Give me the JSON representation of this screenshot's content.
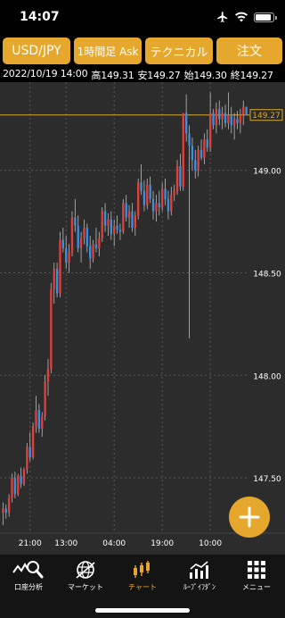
{
  "status_bar": {
    "time": "14:07"
  },
  "toolbar": {
    "symbol": "USD/JPY",
    "period": "1時間足 Ask",
    "technical": "テクニカル",
    "order": "注文"
  },
  "ohlc": {
    "datetime": "2022/10/19 14:00",
    "high": "高149.31",
    "low": "安149.27",
    "open": "始149.30",
    "close": "終149.27"
  },
  "chart_data": {
    "type": "candlestick",
    "y_ticks": [
      "149.00",
      "148.50",
      "148.00",
      "147.50"
    ],
    "y_tick_values": [
      149.0,
      148.5,
      148.0,
      147.5
    ],
    "ylim": [
      147.23,
      149.43
    ],
    "x_ticks": [
      "21:00",
      "13:00",
      "04:00",
      "19:00",
      "10:00"
    ],
    "current_price": "149.27",
    "current_price_value": 149.27,
    "colors": {
      "up": "#e0403a",
      "down": "#3b8fe0",
      "price_line": "#d9a830",
      "grid": "#5a5a5a",
      "background": "#2c2c2c"
    },
    "candles": [
      [
        147.33,
        147.38,
        147.27,
        147.35
      ],
      [
        147.35,
        147.37,
        147.3,
        147.33
      ],
      [
        147.33,
        147.42,
        147.31,
        147.4
      ],
      [
        147.4,
        147.52,
        147.38,
        147.5
      ],
      [
        147.5,
        147.53,
        147.4,
        147.42
      ],
      [
        147.42,
        147.52,
        147.41,
        147.51
      ],
      [
        147.51,
        147.55,
        147.45,
        147.47
      ],
      [
        147.47,
        147.55,
        147.46,
        147.54
      ],
      [
        147.54,
        147.67,
        147.52,
        147.65
      ],
      [
        147.65,
        147.72,
        147.58,
        147.6
      ],
      [
        147.6,
        147.77,
        147.59,
        147.75
      ],
      [
        147.75,
        147.9,
        147.72,
        147.83
      ],
      [
        147.83,
        147.86,
        147.72,
        147.74
      ],
      [
        147.74,
        147.82,
        147.7,
        147.8
      ],
      [
        147.8,
        148.0,
        147.78,
        147.97
      ],
      [
        147.97,
        148.08,
        147.9,
        148.03
      ],
      [
        148.03,
        148.45,
        148.01,
        148.42
      ],
      [
        148.42,
        148.55,
        148.35,
        148.52
      ],
      [
        148.52,
        148.55,
        148.38,
        148.4
      ],
      [
        148.4,
        148.7,
        148.38,
        148.66
      ],
      [
        148.66,
        148.72,
        148.6,
        148.62
      ],
      [
        148.62,
        148.68,
        148.52,
        148.55
      ],
      [
        148.55,
        148.64,
        148.5,
        148.6
      ],
      [
        148.6,
        148.8,
        148.58,
        148.77
      ],
      [
        148.77,
        148.86,
        148.7,
        148.73
      ],
      [
        148.73,
        148.78,
        148.6,
        148.62
      ],
      [
        148.62,
        148.7,
        148.55,
        148.67
      ],
      [
        148.67,
        148.76,
        148.64,
        148.72
      ],
      [
        148.72,
        148.74,
        148.6,
        148.63
      ],
      [
        148.63,
        148.68,
        148.52,
        148.57
      ],
      [
        148.57,
        148.66,
        148.55,
        148.64
      ],
      [
        148.64,
        148.72,
        148.6,
        148.62
      ],
      [
        148.62,
        148.7,
        148.58,
        148.67
      ],
      [
        148.67,
        148.82,
        148.65,
        148.8
      ],
      [
        148.8,
        148.84,
        148.7,
        148.73
      ],
      [
        148.73,
        148.79,
        148.68,
        148.76
      ],
      [
        148.76,
        148.8,
        148.66,
        148.69
      ],
      [
        148.69,
        148.76,
        148.63,
        148.73
      ],
      [
        148.73,
        148.78,
        148.69,
        148.71
      ],
      [
        148.71,
        148.74,
        148.66,
        148.7
      ],
      [
        148.7,
        148.86,
        148.69,
        148.84
      ],
      [
        148.84,
        148.88,
        148.75,
        148.77
      ],
      [
        148.77,
        148.83,
        148.72,
        148.8
      ],
      [
        148.8,
        148.84,
        148.7,
        148.72
      ],
      [
        148.72,
        148.8,
        148.68,
        148.78
      ],
      [
        148.78,
        148.96,
        148.76,
        148.94
      ],
      [
        148.94,
        149.03,
        148.88,
        148.9
      ],
      [
        148.9,
        148.95,
        148.8,
        148.83
      ],
      [
        148.83,
        148.96,
        148.81,
        148.93
      ],
      [
        148.93,
        148.97,
        148.84,
        148.86
      ],
      [
        148.86,
        148.9,
        148.76,
        148.8
      ],
      [
        148.8,
        148.88,
        148.75,
        148.84
      ],
      [
        148.84,
        148.9,
        148.78,
        148.82
      ],
      [
        148.82,
        148.94,
        148.8,
        148.91
      ],
      [
        148.91,
        148.96,
        148.83,
        148.86
      ],
      [
        148.86,
        148.9,
        148.76,
        148.8
      ],
      [
        148.8,
        148.92,
        148.78,
        148.88
      ],
      [
        148.88,
        148.93,
        148.85,
        148.9
      ],
      [
        148.9,
        149.05,
        148.88,
        149.02
      ],
      [
        149.02,
        149.08,
        148.9,
        148.92
      ],
      [
        148.92,
        149.25,
        148.9,
        149.28
      ],
      [
        149.28,
        149.37,
        149.14,
        149.18
      ],
      [
        149.18,
        149.22,
        148.18,
        149.12
      ],
      [
        149.12,
        149.16,
        149.0,
        149.05
      ],
      [
        149.05,
        149.1,
        148.96,
        149.0
      ],
      [
        149.0,
        149.12,
        148.97,
        149.1
      ],
      [
        149.1,
        149.15,
        149.05,
        149.06
      ],
      [
        149.06,
        149.18,
        149.03,
        149.15
      ],
      [
        149.15,
        149.2,
        149.09,
        149.11
      ],
      [
        149.11,
        149.38,
        149.09,
        149.28
      ],
      [
        149.28,
        149.3,
        149.2,
        149.22
      ],
      [
        149.22,
        149.33,
        149.18,
        149.3
      ],
      [
        149.3,
        149.34,
        149.22,
        149.25
      ],
      [
        149.25,
        149.31,
        149.2,
        149.28
      ],
      [
        149.28,
        149.32,
        149.21,
        149.23
      ],
      [
        149.23,
        149.38,
        149.2,
        149.27
      ],
      [
        149.27,
        149.31,
        149.18,
        149.22
      ],
      [
        149.22,
        149.28,
        149.15,
        149.25
      ],
      [
        149.25,
        149.29,
        149.2,
        149.23
      ],
      [
        149.23,
        149.3,
        149.18,
        149.27
      ],
      [
        149.27,
        149.34,
        149.22,
        149.31
      ],
      [
        149.31,
        149.31,
        149.27,
        149.27
      ]
    ]
  },
  "fab": {
    "icon": "plus-icon"
  },
  "tabs": [
    {
      "label": "口座分析",
      "icon": "account-analysis-icon"
    },
    {
      "label": "マーケット",
      "icon": "market-globe-icon"
    },
    {
      "label": "チャート",
      "icon": "candlestick-chart-icon",
      "active": true
    },
    {
      "label": "ﾙｰﾌﾟｲﾌﾀﾞﾝ",
      "icon": "loop-ifdone-icon"
    },
    {
      "label": "メニュー",
      "icon": "menu-grid-icon"
    }
  ]
}
